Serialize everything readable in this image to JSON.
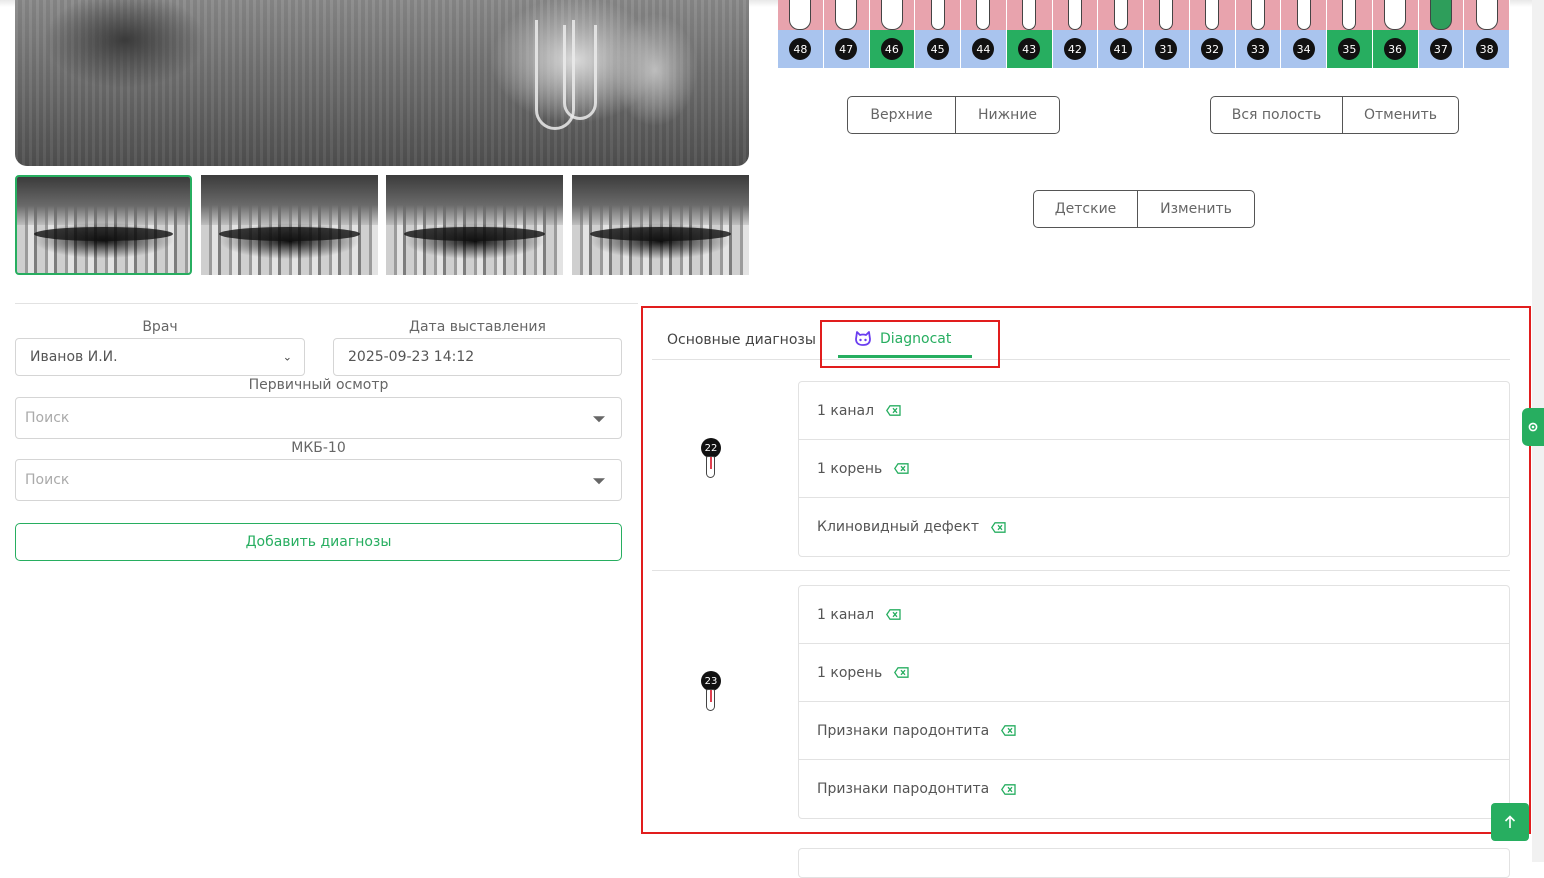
{
  "tooth_chart": {
    "numbers": [
      "48",
      "47",
      "46",
      "45",
      "44",
      "43",
      "42",
      "41",
      "31",
      "32",
      "33",
      "34",
      "35",
      "36",
      "37",
      "38"
    ],
    "highlighted": [
      "46",
      "43",
      "35",
      "36"
    ]
  },
  "jaw_buttons": {
    "upper": "Верхние",
    "lower": "Нижние"
  },
  "cavity_buttons": {
    "all": "Вся полость",
    "cancel": "Отменить"
  },
  "mode_buttons": {
    "children": "Детские",
    "change": "Изменить"
  },
  "form": {
    "doctor_label": "Врач",
    "doctor_value": "Иванов И.И.",
    "date_label": "Дата выставления",
    "date_value": "2025-09-23 14:12",
    "primary_label": "Первичный осмотр",
    "primary_placeholder": "Поиск",
    "icd_label": "МКБ-10",
    "icd_placeholder": "Поиск",
    "add_button": "Добавить диагнозы"
  },
  "tabs": {
    "main": "Основные диагнозы",
    "diagnocat": "Diagnocat"
  },
  "diagnoses": [
    {
      "tooth": "22",
      "items": [
        "1 канал",
        "1 корень",
        "Клиновидный дефект"
      ]
    },
    {
      "tooth": "23",
      "items": [
        "1 канал",
        "1 корень",
        "Признаки пародонтита",
        "Признаки пародонтита"
      ]
    }
  ],
  "colors": {
    "accent": "#27ae60",
    "highlight_box": "#e11d1d",
    "tooth_top": "#e8a3ad",
    "tooth_bottom": "#a9c4ee"
  }
}
